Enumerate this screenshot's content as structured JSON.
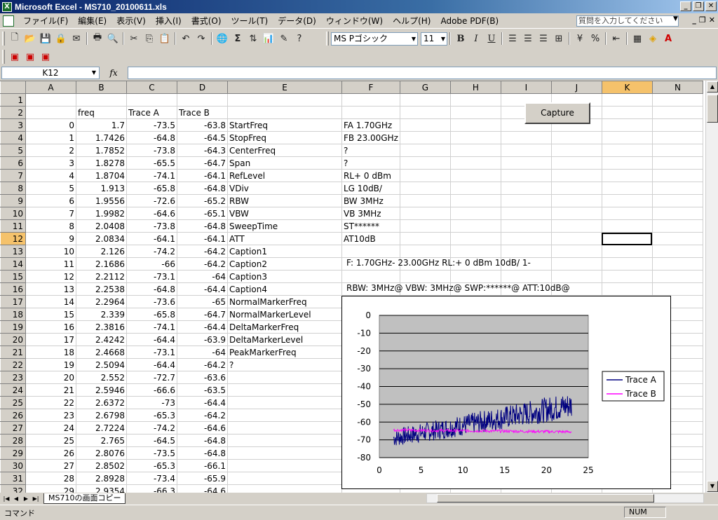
{
  "window": {
    "title": "Microsoft Excel - MS710_20100611.xls"
  },
  "menu": {
    "items": [
      "ファイル(F)",
      "編集(E)",
      "表示(V)",
      "挿入(I)",
      "書式(O)",
      "ツール(T)",
      "データ(D)",
      "ウィンドウ(W)",
      "ヘルプ(H)",
      "Adobe PDF(B)"
    ],
    "help_placeholder": "質問を入力してください"
  },
  "toolbar": {
    "font_name": "MS Pゴシック",
    "font_size": "11",
    "percent": "%"
  },
  "formula_bar": {
    "cell_ref": "K12",
    "fx": "fx"
  },
  "columns": [
    "A",
    "B",
    "C",
    "D",
    "E",
    "F",
    "G",
    "H",
    "I",
    "J",
    "K",
    "N"
  ],
  "headers_row2": {
    "B": "freq",
    "C": "Trace A",
    "D": "Trace B"
  },
  "rows": [
    {
      "r": "1",
      "A": "",
      "B": "",
      "C": "",
      "D": "",
      "E": "",
      "F": ""
    },
    {
      "r": "2",
      "A": "",
      "B": "freq",
      "C": "Trace A",
      "D": "Trace B",
      "E": "",
      "F": ""
    },
    {
      "r": "3",
      "A": "0",
      "B": "1.7",
      "C": "-73.5",
      "D": "-63.8",
      "E": "StartFreq",
      "F": "FA    1.70GHz"
    },
    {
      "r": "4",
      "A": "1",
      "B": "1.7426",
      "C": "-64.8",
      "D": "-64.5",
      "E": "StopFreq",
      "F": "FB   23.00GHz"
    },
    {
      "r": "5",
      "A": "2",
      "B": "1.7852",
      "C": "-73.8",
      "D": "-64.3",
      "E": "CenterFreq",
      "F": "?"
    },
    {
      "r": "6",
      "A": "3",
      "B": "1.8278",
      "C": "-65.5",
      "D": "-64.7",
      "E": "Span",
      "F": "?"
    },
    {
      "r": "7",
      "A": "4",
      "B": "1.8704",
      "C": "-74.1",
      "D": "-64.1",
      "E": "RefLevel",
      "F": "RL+    0 dBm"
    },
    {
      "r": "8",
      "A": "5",
      "B": "1.913",
      "C": "-65.8",
      "D": "-64.8",
      "E": "VDiv",
      "F": "LG 10dB/"
    },
    {
      "r": "9",
      "A": "6",
      "B": "1.9556",
      "C": "-72.6",
      "D": "-65.2",
      "E": "RBW",
      "F": "BW  3MHz"
    },
    {
      "r": "10",
      "A": "7",
      "B": "1.9982",
      "C": "-64.6",
      "D": "-65.1",
      "E": "VBW",
      "F": "VB  3MHz"
    },
    {
      "r": "11",
      "A": "8",
      "B": "2.0408",
      "C": "-73.8",
      "D": "-64.8",
      "E": "SweepTime",
      "F": "ST******"
    },
    {
      "r": "12",
      "A": "9",
      "B": "2.0834",
      "C": "-64.1",
      "D": "-64.1",
      "E": "ATT",
      "F": "AT10dB"
    },
    {
      "r": "13",
      "A": "10",
      "B": "2.126",
      "C": "-74.2",
      "D": "-64.2",
      "E": "Caption1",
      "F": ""
    },
    {
      "r": "14",
      "A": "11",
      "B": "2.1686",
      "C": "-66",
      "D": "-64.2",
      "E": "Caption2",
      "F": ""
    },
    {
      "r": "15",
      "A": "12",
      "B": "2.2112",
      "C": "-73.1",
      "D": "-64",
      "E": "Caption3",
      "F": ""
    },
    {
      "r": "16",
      "A": "13",
      "B": "2.2538",
      "C": "-64.8",
      "D": "-64.4",
      "E": "Caption4",
      "F": ""
    },
    {
      "r": "17",
      "A": "14",
      "B": "2.2964",
      "C": "-73.6",
      "D": "-65",
      "E": "NormalMarkerFreq",
      "F": ""
    },
    {
      "r": "18",
      "A": "15",
      "B": "2.339",
      "C": "-65.8",
      "D": "-64.7",
      "E": "NormalMarkerLevel",
      "F": ""
    },
    {
      "r": "19",
      "A": "16",
      "B": "2.3816",
      "C": "-74.1",
      "D": "-64.4",
      "E": "DeltaMarkerFreq",
      "F": ""
    },
    {
      "r": "20",
      "A": "17",
      "B": "2.4242",
      "C": "-64.4",
      "D": "-63.9",
      "E": "DeltaMarkerLevel",
      "F": ""
    },
    {
      "r": "21",
      "A": "18",
      "B": "2.4668",
      "C": "-73.1",
      "D": "-64",
      "E": "PeakMarkerFreq",
      "F": ""
    },
    {
      "r": "22",
      "A": "19",
      "B": "2.5094",
      "C": "-64.4",
      "D": "-64.2",
      "E": "?",
      "F": ""
    },
    {
      "r": "23",
      "A": "20",
      "B": "2.552",
      "C": "-72.7",
      "D": "-63.6",
      "E": "",
      "F": ""
    },
    {
      "r": "24",
      "A": "21",
      "B": "2.5946",
      "C": "-66.6",
      "D": "-63.5",
      "E": "",
      "F": ""
    },
    {
      "r": "25",
      "A": "22",
      "B": "2.6372",
      "C": "-73",
      "D": "-64.4",
      "E": "",
      "F": ""
    },
    {
      "r": "26",
      "A": "23",
      "B": "2.6798",
      "C": "-65.3",
      "D": "-64.2",
      "E": "",
      "F": ""
    },
    {
      "r": "27",
      "A": "24",
      "B": "2.7224",
      "C": "-74.2",
      "D": "-64.6",
      "E": "",
      "F": ""
    },
    {
      "r": "28",
      "A": "25",
      "B": "2.765",
      "C": "-64.5",
      "D": "-64.8",
      "E": "",
      "F": ""
    },
    {
      "r": "29",
      "A": "26",
      "B": "2.8076",
      "C": "-73.5",
      "D": "-64.8",
      "E": "",
      "F": ""
    },
    {
      "r": "30",
      "A": "27",
      "B": "2.8502",
      "C": "-65.3",
      "D": "-66.1",
      "E": "",
      "F": ""
    },
    {
      "r": "31",
      "A": "28",
      "B": "2.8928",
      "C": "-73.4",
      "D": "-65.9",
      "E": "",
      "F": ""
    },
    {
      "r": "32",
      "A": "29",
      "B": "2.9354",
      "C": "-66.3",
      "D": "-64.6",
      "E": "",
      "F": ""
    }
  ],
  "caption_line_1": "F:    1.70GHz-    23.00GHz    RL:+     0 dBm 10dB/   1-",
  "caption_line_2": "RBW:  3MHz@  VBW:  3MHz@  SWP:******@   ATT:10dB@",
  "capture_button": "Capture",
  "sheet_tab": "MS710の画面コピー",
  "status": {
    "mode": "コマンド",
    "num": "NUM"
  },
  "chart_data": {
    "type": "line",
    "xlim": [
      0,
      25
    ],
    "ylim": [
      -80,
      0
    ],
    "xticks": [
      "0",
      "5",
      "10",
      "15",
      "20",
      "25"
    ],
    "yticks": [
      "0",
      "-10",
      "-20",
      "-30",
      "-40",
      "-50",
      "-60",
      "-70",
      "-80"
    ],
    "grid": true,
    "legend": "right",
    "series": [
      {
        "name": "Trace A",
        "color": "#000080",
        "x_start": 1.7,
        "x_end": 23.0,
        "y_start_low": -74,
        "y_start_high": -64,
        "y_end_low": -58,
        "y_end_high": -43
      },
      {
        "name": "Trace B",
        "color": "#ff00ff",
        "x_start": 1.7,
        "x_end": 23.0,
        "y_start": -64.5,
        "y_end": -65.5
      }
    ],
    "plot_bg": "#c0c0c0"
  }
}
